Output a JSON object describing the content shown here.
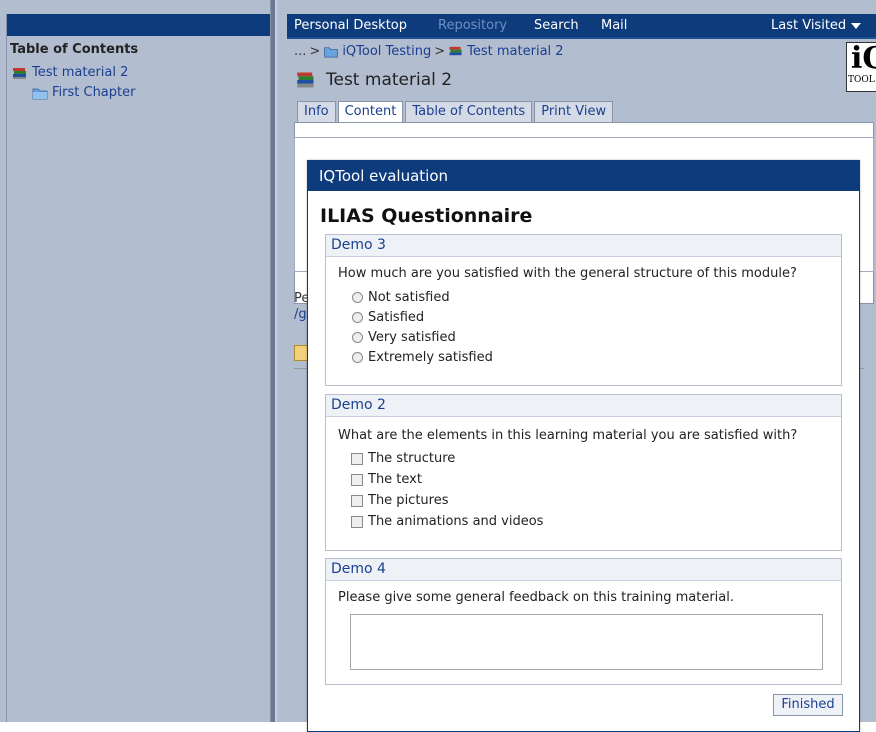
{
  "sidebar": {
    "title": "Table of Contents",
    "items": [
      {
        "label": "Test material 2",
        "icon": "books-icon"
      },
      {
        "label": "First Chapter",
        "icon": "folder-icon"
      }
    ]
  },
  "topnav": {
    "items": [
      "Personal Desktop",
      "Repository",
      "Search",
      "Mail"
    ],
    "last_visited": "Last Visited"
  },
  "breadcrumb": {
    "ellipsis": "...",
    "sep": ">",
    "items": [
      "iQTool Testing",
      "Test material 2"
    ]
  },
  "page": {
    "title": "Test material 2",
    "logo_big": "iQ",
    "logo_small": "TOOL"
  },
  "tabs": [
    "Info",
    "Content",
    "Table of Contents",
    "Print View"
  ],
  "behind": {
    "text1": "Pe",
    "text2": "/g"
  },
  "modal": {
    "header": "IQTool evaluation",
    "title": "ILIAS Questionnaire",
    "q1": {
      "heading": "Demo 3",
      "question": "How much are you satisfied with the general structure of this module?",
      "options": [
        "Not satisfied",
        "Satisfied",
        "Very satisfied",
        "Extremely satisfied"
      ]
    },
    "q2": {
      "heading": "Demo 2",
      "question": "What are the elements in this learning material you are satisfied with?",
      "options": [
        "The structure",
        "The text",
        "The pictures",
        "The animations and videos"
      ]
    },
    "q3": {
      "heading": "Demo 4",
      "question": "Please give some general feedback on this training material.",
      "value": ""
    },
    "finish": "Finished"
  },
  "colors": {
    "nav_bg": "#0d3b7b",
    "pane_bg": "#b3bdd0",
    "link": "#1a3f8f"
  }
}
